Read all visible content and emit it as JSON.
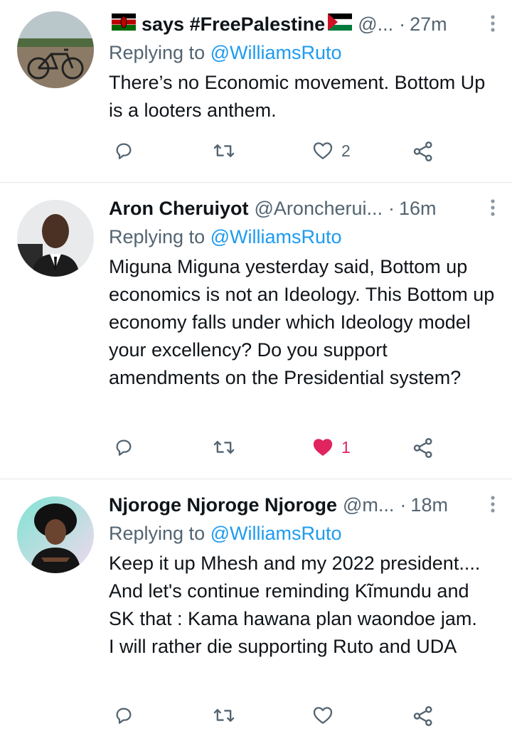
{
  "tweets": [
    {
      "name_suffix": "says #FreePalestine",
      "handle": "@...",
      "time": "27m",
      "replying_prefix": "Replying to ",
      "replying_to": "@WilliamsRuto",
      "text": "There’s no Economic movement. Bottom Up is a looters anthem.",
      "likes": "2",
      "liked": false
    },
    {
      "name": "Aron Cheruiyot",
      "handle": "@Aroncherui...",
      "time": "16m",
      "replying_prefix": "Replying to ",
      "replying_to": "@WilliamsRuto",
      "text": "Miguna Miguna yesterday said, Bottom up economics is not an Ideology. This Bottom up economy falls under which Ideology model your excellency? Do you support amendments on the Presidential system?",
      "likes": "1",
      "liked": true
    },
    {
      "name": "Njoroge Njoroge Njoroge",
      "handle": "@m...",
      "time": "18m",
      "replying_prefix": "Replying to ",
      "replying_to": "@WilliamsRuto",
      "text": "Keep it up Mhesh and my 2022 president.... And let's continue reminding Kĩmundu and SK that : Kama hawana plan waondoe jam.\nI will rather die supporting Ruto and UDA",
      "likes": "",
      "liked": false
    }
  ],
  "colors": {
    "text": "#0f1419",
    "secondary": "#536471",
    "link": "#1d9bf0",
    "like_active": "#e0245e",
    "divider": "#e1e6ea"
  },
  "icons": [
    "reply-icon",
    "retweet-icon",
    "like-icon",
    "share-icon",
    "more-options-icon",
    "kenya-flag-icon",
    "palestine-flag-icon"
  ]
}
